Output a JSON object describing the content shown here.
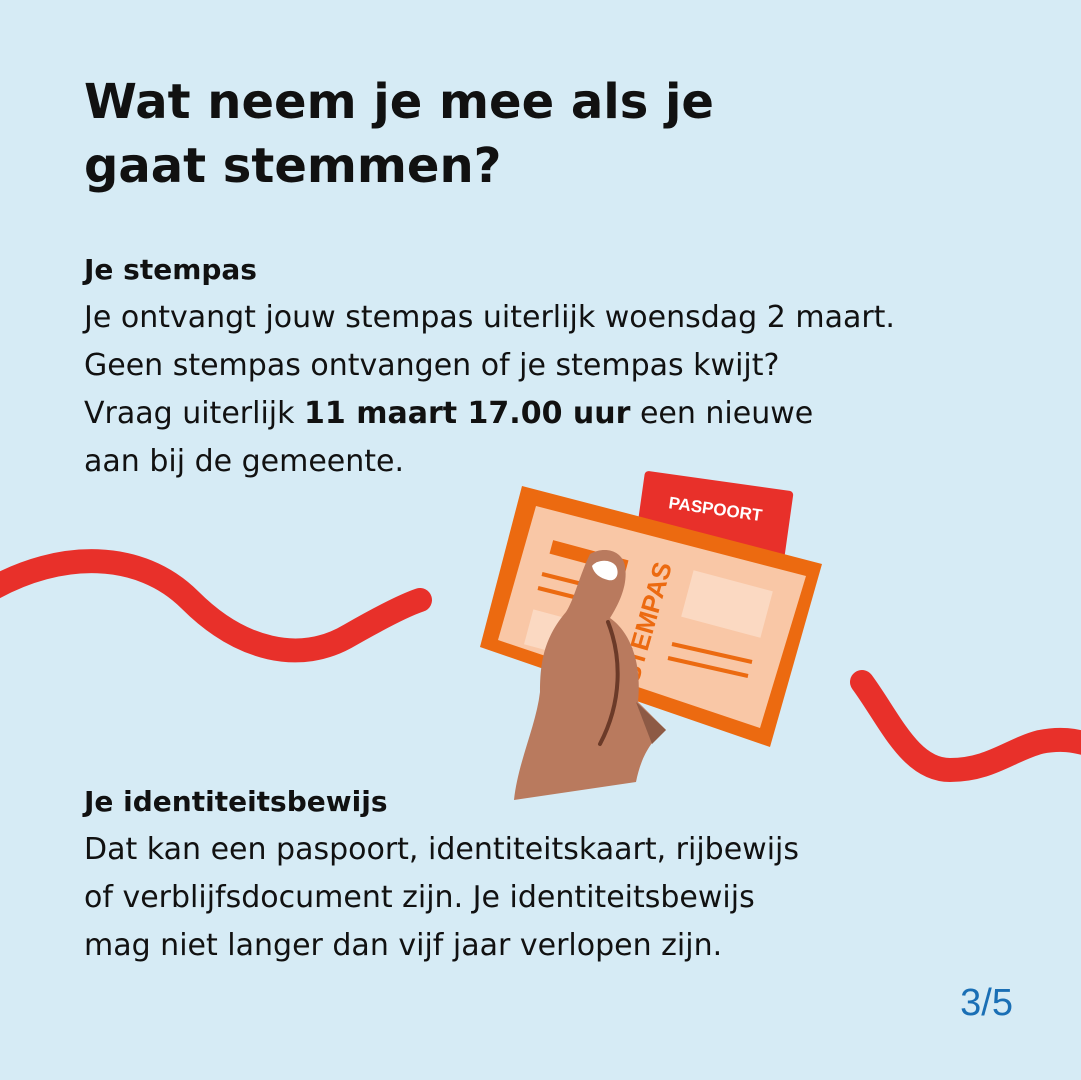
{
  "title": {
    "line1": "Wat neem je mee als je",
    "line2": "gaat stemmen?"
  },
  "stempas_section": {
    "heading": "Je stempas",
    "line1": "Je ontvangt jouw stempas uiterlijk woensdag 2 maart.",
    "line2": "Geen stempas ontvangen of je stempas kwijt?",
    "line3_pre": "Vraag uiterlijk ",
    "line3_bold": "11 maart 17.00 uur",
    "line3_post": " een nieuwe",
    "line4": "aan bij de gemeente."
  },
  "id_section": {
    "heading": "Je identiteitsbewijs",
    "line1": "Dat kan een paspoort, identiteitskaart, rijbewijs",
    "line2": "of verblijfsdocument zijn. Je identiteitsbewijs",
    "line3": "mag niet langer dan vijf jaar verlopen zijn."
  },
  "illustration": {
    "passport_label": "PASPOORT",
    "card_label": "STEMPAS"
  },
  "page_indicator": "3/5",
  "colors": {
    "background": "#d6ebf5",
    "wave_red": "#e8302a",
    "card_border": "#ec6a10",
    "card_fill": "#f9c7a6",
    "hand": "#b97a5e",
    "page_indicator": "#1a6fb5"
  }
}
